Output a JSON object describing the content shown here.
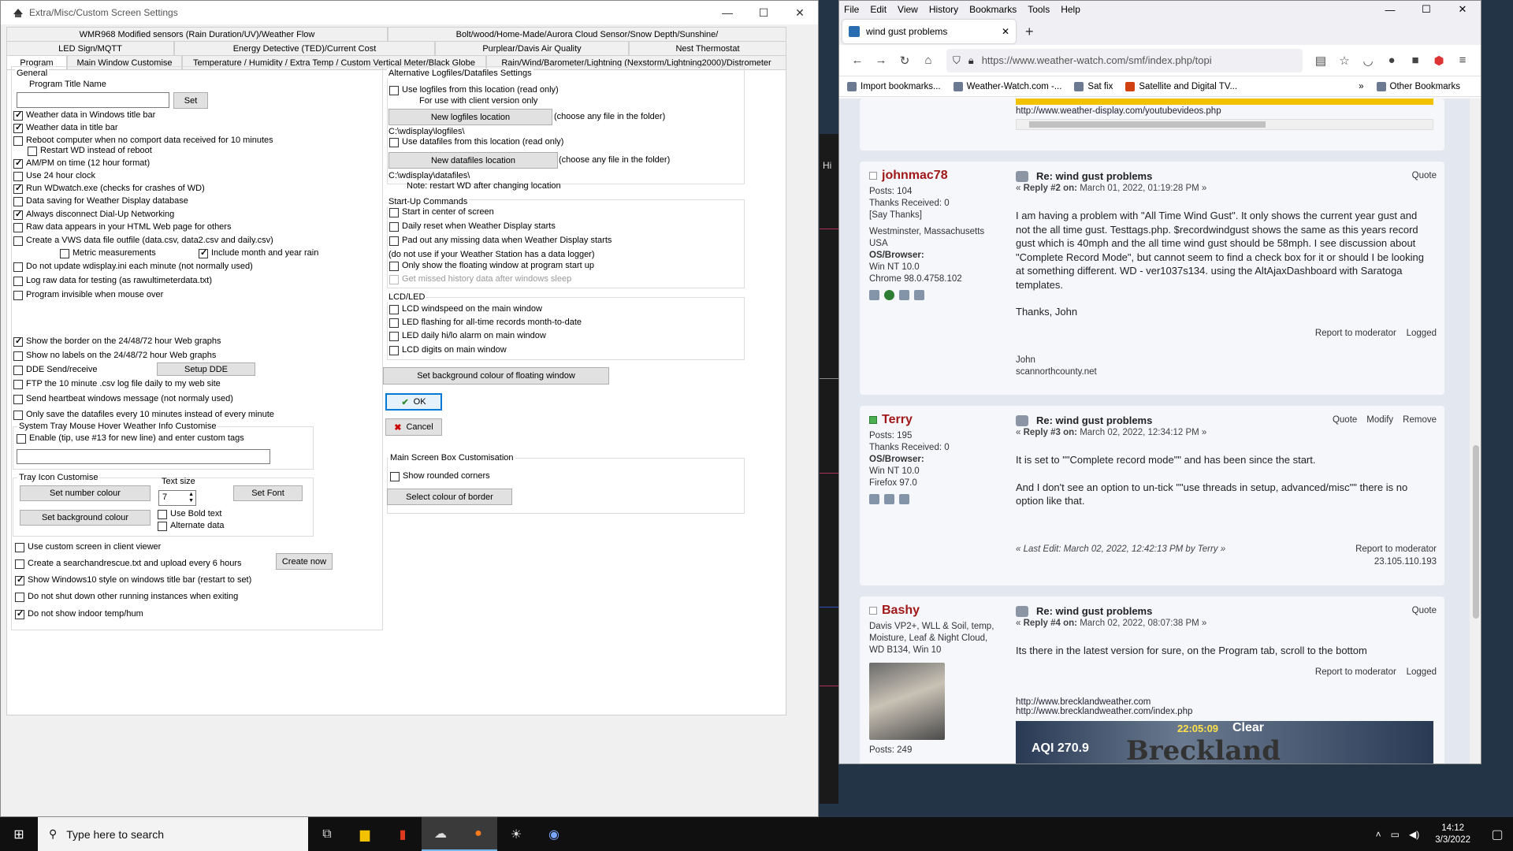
{
  "wd": {
    "title": "Extra/Misc/Custom Screen Settings",
    "tab_rows": [
      [
        "WMR968 Modified sensors (Rain Duration/UV)/Weather Flow",
        "Bolt/wood/Home-Made/Aurora Cloud Sensor/Snow Depth/Sunshine/"
      ],
      [
        "LED Sign/MQTT",
        "Energy Detective (TED)/Current Cost",
        "Purplear/Davis Air Quality",
        "Nest Thermostat"
      ],
      [
        "Program",
        "Main Window Customise",
        "Temperature / Humidity / Extra Temp / Custom Vertical Meter/Black Globe",
        "Rain/Wind/Barometer/Lightning (Nexstorm/Lightning2000)/Distrometer"
      ]
    ],
    "general_label": "General",
    "program_title_label": "Program Title Name",
    "set_label": "Set",
    "left_checks": [
      {
        "label": "Weather data in Windows title bar",
        "on": true
      },
      {
        "label": "Weather data in title bar",
        "on": true
      },
      {
        "label": "Reboot computer when no comport data received  for 10 minutes",
        "on": false
      },
      {
        "label": "Restart WD instead of reboot",
        "on": false
      },
      {
        "label": "AM/PM on time (12 hour format)",
        "on": true
      },
      {
        "label": "Use 24 hour clock",
        "on": false
      },
      {
        "label": "Run WDwatch.exe (checks for crashes of WD)",
        "on": true
      },
      {
        "label": "Data saving for Weather Display database",
        "on": false
      },
      {
        "label": "Always disconnect Dial-Up Networking",
        "on": true
      },
      {
        "label": "Raw data appears in your HTML Web page for others",
        "on": false
      },
      {
        "label": "Create a VWS data file outfile (data.csv, data2.csv and daily.csv)",
        "on": false
      },
      {
        "label": "Metric measurements",
        "on": false
      },
      {
        "label": "Include month and year rain",
        "on": true
      },
      {
        "label": "Do not update wdisplay.ini each minute (not normally used)",
        "on": false
      },
      {
        "label": "Log raw data for testing (as rawultimeterdata.txt)",
        "on": false
      },
      {
        "label": "Program invisible when mouse over",
        "on": false
      },
      {
        "label": "Show the border on the 24/48/72 hour Web graphs",
        "on": true
      },
      {
        "label": "Show no labels on the 24/48/72 hour Web graphs",
        "on": false
      },
      {
        "label": "DDE Send/receive",
        "on": false
      },
      {
        "label": "FTP the 10 minute .csv log file daily to my web site",
        "on": false
      },
      {
        "label": "Send heartbeat windows message (not normaly used)",
        "on": false
      },
      {
        "label": "Only save the datafiles every 10 minutes instead of every minute",
        "on": false
      }
    ],
    "setup_dde": "Setup DDE",
    "tray_hover_label": "System Tray Mouse Hover Weather Info Customise",
    "tray_hover_check": "Enable (tip, use #13 for new line) and enter custom tags",
    "tray_icon_label": "Tray Icon Customise",
    "text_size_label": "Text size",
    "text_size_value": "7",
    "set_number_colour": "Set number colour",
    "set_font": "Set Font",
    "set_background_colour": "Set background colour",
    "use_bold_text": "Use Bold text",
    "alternate_data": "Alternate data",
    "bottom_checks": [
      {
        "label": "Use custom screen in client viewer",
        "on": false
      },
      {
        "label": "Create a searchandrescue.txt and upload every 6 hours",
        "on": false
      },
      {
        "label": "Show Windows10 style on windows title bar (restart to set)",
        "on": true
      },
      {
        "label": "Do not shut down other running instances when exiting",
        "on": false
      },
      {
        "label": "Do not show indoor temp/hum",
        "on": true
      }
    ],
    "create_now": "Create now",
    "alt_logfiles_label": "Alternative Logfiles/Datafiles Settings",
    "use_logfiles": "Use logfiles from this location (read only)",
    "client_version_only": "For use with  client version only",
    "new_logfiles_location": "New logfiles location",
    "choose_file_1": "(choose any file in the folder)",
    "logfiles_path": "C:\\wdisplay\\logfiles\\",
    "use_datafiles": "Use datafiles from this location (read only)",
    "new_datafiles_location": "New datafiles location",
    "choose_file_2": "(choose any file in the folder)",
    "datafiles_path": "C:\\wdisplay\\datafiles\\",
    "restart_note": "Note: restart WD after changing location",
    "startup_label": "Start-Up Commands",
    "startup_checks": [
      {
        "label": "Start in center of screen",
        "on": false
      },
      {
        "label": "Daily reset when Weather Display starts",
        "on": false
      },
      {
        "label": "Pad out any missing data when Weather Display starts",
        "on": false
      }
    ],
    "data_logger_note": "(do not use if your Weather Station has a data logger)",
    "floating_check": "Only show the floating window at program start up",
    "missed_history": "Get missed history data after windows sleep",
    "lcd_label": "LCD/LED",
    "lcd_checks": [
      {
        "label": "LCD windspeed on the main window",
        "on": false
      },
      {
        "label": "LED flashing for all-time records month-to-date",
        "on": false
      },
      {
        "label": "LED daily hi/lo alarm on main window",
        "on": false
      },
      {
        "label": "LCD digits on main window",
        "on": false
      }
    ],
    "floating_bg": "Set background colour of floating window",
    "ok": "OK",
    "cancel": "Cancel",
    "main_box_label": "Main Screen Box Customisation",
    "rounded_corners": "Show rounded corners",
    "border_colour": "Select colour of border"
  },
  "desk_label": "Hi",
  "firefox": {
    "menu": [
      "File",
      "Edit",
      "View",
      "History",
      "Bookmarks",
      "Tools",
      "Help"
    ],
    "tab_title": "wind gust problems",
    "url": "https://www.weather-watch.com/smf/index.php/topi",
    "bookmarks": [
      "Import bookmarks...",
      "Weather-Watch.com -...",
      "Sat fix",
      "Satellite and Digital TV..."
    ],
    "other_bookmarks": "Other Bookmarks",
    "top_link": "http://www.weather-display.com/youtubevideos.php",
    "posts": [
      {
        "user": "johnmac78",
        "online": false,
        "stats": [
          "Posts: 104",
          "Thanks Received: 0",
          "[Say Thanks]",
          "Westminster, Massachusetts USA"
        ],
        "os_label": "OS/Browser:",
        "os": [
          "Win NT 10.0",
          "Chrome 98.0.4758.102"
        ],
        "title": "Re: wind gust problems",
        "meta_reply": "Reply #2 on:",
        "meta_date": "March 01, 2022, 01:19:28 PM »",
        "actions": [
          "Quote"
        ],
        "text": "I am having a problem with \"All Time Wind Gust\". It only shows the current year gust and not the all time gust. Testtags.php. $recordwindgust shows the same as this years record gust which is 40mph and the all time wind gust should be 58mph. I see discussion about \"Complete Record Mode\", but cannot seem to find a check box for it or should I be looking at something different. WD - ver1037s134. using the AltAjaxDashboard with Saratoga templates.",
        "text2": "Thanks, John",
        "report": "Report to moderator",
        "logged": "Logged",
        "sig": [
          "John",
          "scannorthcounty.net"
        ]
      },
      {
        "user": "Terry",
        "online": true,
        "stats": [
          "Posts: 195",
          "Thanks Received: 0"
        ],
        "os_label": "OS/Browser:",
        "os": [
          "Win NT 10.0",
          "Firefox 97.0"
        ],
        "title": "Re: wind gust problems",
        "meta_reply": "Reply #3 on:",
        "meta_date": "March 02, 2022, 12:34:12 PM »",
        "actions": [
          "Quote",
          "Modify",
          "Remove"
        ],
        "text": "It is set to \"\"Complete record mode\"\" and has been since the start.",
        "text2": "And I don't see an option to un-tick \"\"use threads in setup, advanced/misc\"\" there is no option like that.",
        "last_edit": "« Last Edit: March 02, 2022, 12:42:13 PM by Terry »",
        "report": "Report to moderator",
        "ip": "23.105.110.193"
      },
      {
        "user": "Bashy",
        "online": false,
        "stats": [
          "Davis VP2+, WLL & Soil, temp, Moisture, Leaf & Night Cloud, WD B134, Win 10"
        ],
        "stats2": [
          "Posts: 249"
        ],
        "title": "Re: wind gust problems",
        "meta_reply": "Reply #4 on:",
        "meta_date": "March 02, 2022, 08:07:38 PM »",
        "actions": [
          "Quote"
        ],
        "text": "Its there in the latest version for sure, on the Program tab, scroll to the bottom",
        "report": "Report to moderator",
        "logged": "Logged",
        "links": [
          "http://www.brecklandweather.com",
          "http://www.brecklandweather.com/index.php"
        ],
        "banner_time": "22:05:09",
        "banner_cond": "Clear",
        "banner_aqi": "AQI 270.9",
        "banner_name": "Breckland"
      }
    ]
  },
  "taskbar": {
    "search_placeholder": "Type here to search",
    "time": "14:12",
    "date": "3/3/2022"
  }
}
